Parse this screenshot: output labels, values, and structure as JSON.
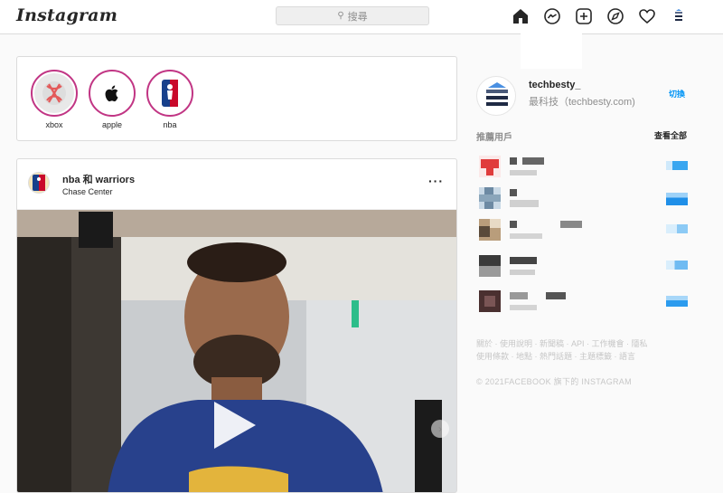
{
  "header": {
    "logo": "Instagram",
    "search_placeholder": "搜尋",
    "nav_icons": [
      "home-icon",
      "messenger-icon",
      "new-post-icon",
      "explore-icon",
      "activity-heart-icon",
      "profile-icon"
    ]
  },
  "stories": [
    {
      "label": "xbox",
      "icon": "xbox-logo"
    },
    {
      "label": "apple",
      "icon": "apple-logo"
    },
    {
      "label": "nba",
      "icon": "nba-logo"
    }
  ],
  "post": {
    "user": "nba 和 warriors",
    "location": "Chase Center",
    "more": "···"
  },
  "profile": {
    "username": "techbesty_",
    "display_name": "最科技（techbesty.com)",
    "switch_label": "切換"
  },
  "suggestions": {
    "title": "推薦用戶",
    "see_all": "查看全部"
  },
  "footer": {
    "links_line1": "關於 · 使用說明 · 新聞稿 · API · 工作機會 · 隱私",
    "links_line2": "使用條款 · 地點 · 熱門話題 · 主題標籤 · 語言",
    "copyright": "© 2021FACEBOOK 旗下的 INSTAGRAM"
  },
  "colors": {
    "accent": "#0095f6",
    "story_ring": "#c13584",
    "border": "#dbdbdb"
  }
}
